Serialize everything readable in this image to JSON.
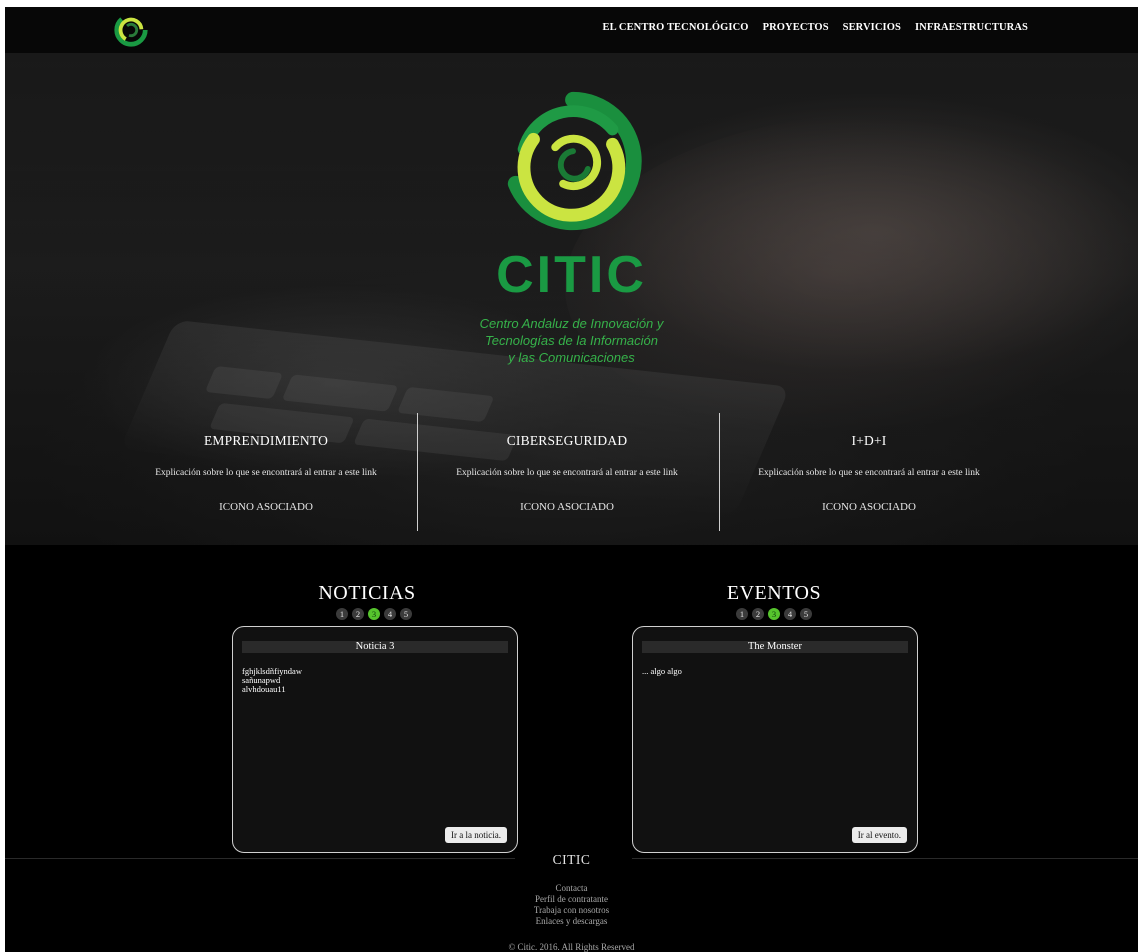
{
  "colors": {
    "brand_green": "#1a9a43",
    "tagline_green": "#36b24a",
    "pager_active": "#56c42d",
    "logo_yellow": "#cbe441",
    "background": "#000000"
  },
  "nav": {
    "logo_icon": "citic-logo-icon",
    "items": [
      {
        "label": "EL CENTRO TECNOLÓGICO"
      },
      {
        "label": "PROYECTOS"
      },
      {
        "label": "SERVICIOS"
      },
      {
        "label": "INFRAESTRUCTURAS"
      }
    ]
  },
  "hero": {
    "logo_icon": "citic-logo-icon",
    "brand": "CITIC",
    "tagline": [
      "Centro Andaluz de Innovación y",
      "Tecnologías de la Información",
      "y las Comunicaciones"
    ]
  },
  "features": [
    {
      "title": "EMPRENDIMIENTO",
      "description": "Explicación sobre lo que se encontrará al entrar a este link",
      "icon_label": "ICONO ASOCIADO"
    },
    {
      "title": "CIBERSEGURIDAD",
      "description": "Explicación sobre lo que se encontrará al entrar a este link",
      "icon_label": "ICONO ASOCIADO"
    },
    {
      "title": "I+D+I",
      "description": "Explicación sobre lo que se encontrará al entrar a este link",
      "icon_label": "ICONO ASOCIADO"
    }
  ],
  "news": {
    "title": "NOTICIAS",
    "pages": [
      "1",
      "2",
      "3",
      "4",
      "5"
    ],
    "active_page": "3",
    "card_title": "Noticia 3",
    "card_body": "fghjklsdñfiyndaw\nsañunapwd\nalvhdouau11",
    "button": "Ir a la noticia."
  },
  "events": {
    "title": "EVENTOS",
    "pages": [
      "1",
      "2",
      "3",
      "4",
      "5"
    ],
    "active_page": "3",
    "card_title": "The Monster",
    "card_body": "... algo algo",
    "button": "Ir al evento."
  },
  "footer": {
    "brand": "CITIC",
    "links": [
      "Contacta",
      "Perfil de contratante",
      "Trabaja con nosotros",
      "Enlaces y descargas"
    ],
    "copyright": "© Citic. 2016. All Rights Reserved"
  }
}
